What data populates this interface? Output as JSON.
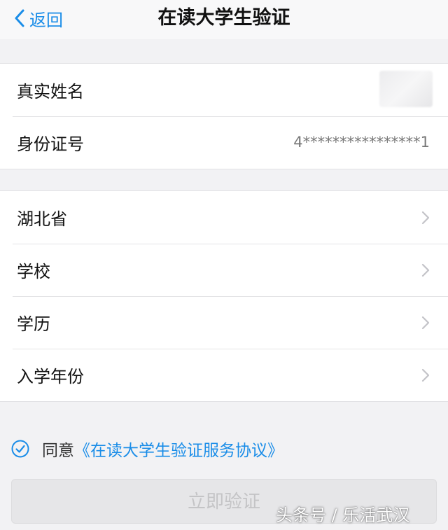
{
  "nav": {
    "back_label": "返回",
    "title": "在读大学生验证"
  },
  "identity": {
    "name_label": "真实姓名",
    "id_label": "身份证号",
    "id_value": "4****************1"
  },
  "education": {
    "items": [
      {
        "label": "湖北省"
      },
      {
        "label": "学校"
      },
      {
        "label": "学历"
      },
      {
        "label": "入学年份"
      }
    ]
  },
  "agreement": {
    "checked": true,
    "prefix": "同意",
    "link_text": "《在读大学生验证服务协议》"
  },
  "submit": {
    "label": "立即验证",
    "enabled": false
  },
  "watermark": {
    "text": "头条号 / 乐活武汉"
  },
  "colors": {
    "accent": "#1a8de8",
    "background": "#f2f2f4"
  }
}
